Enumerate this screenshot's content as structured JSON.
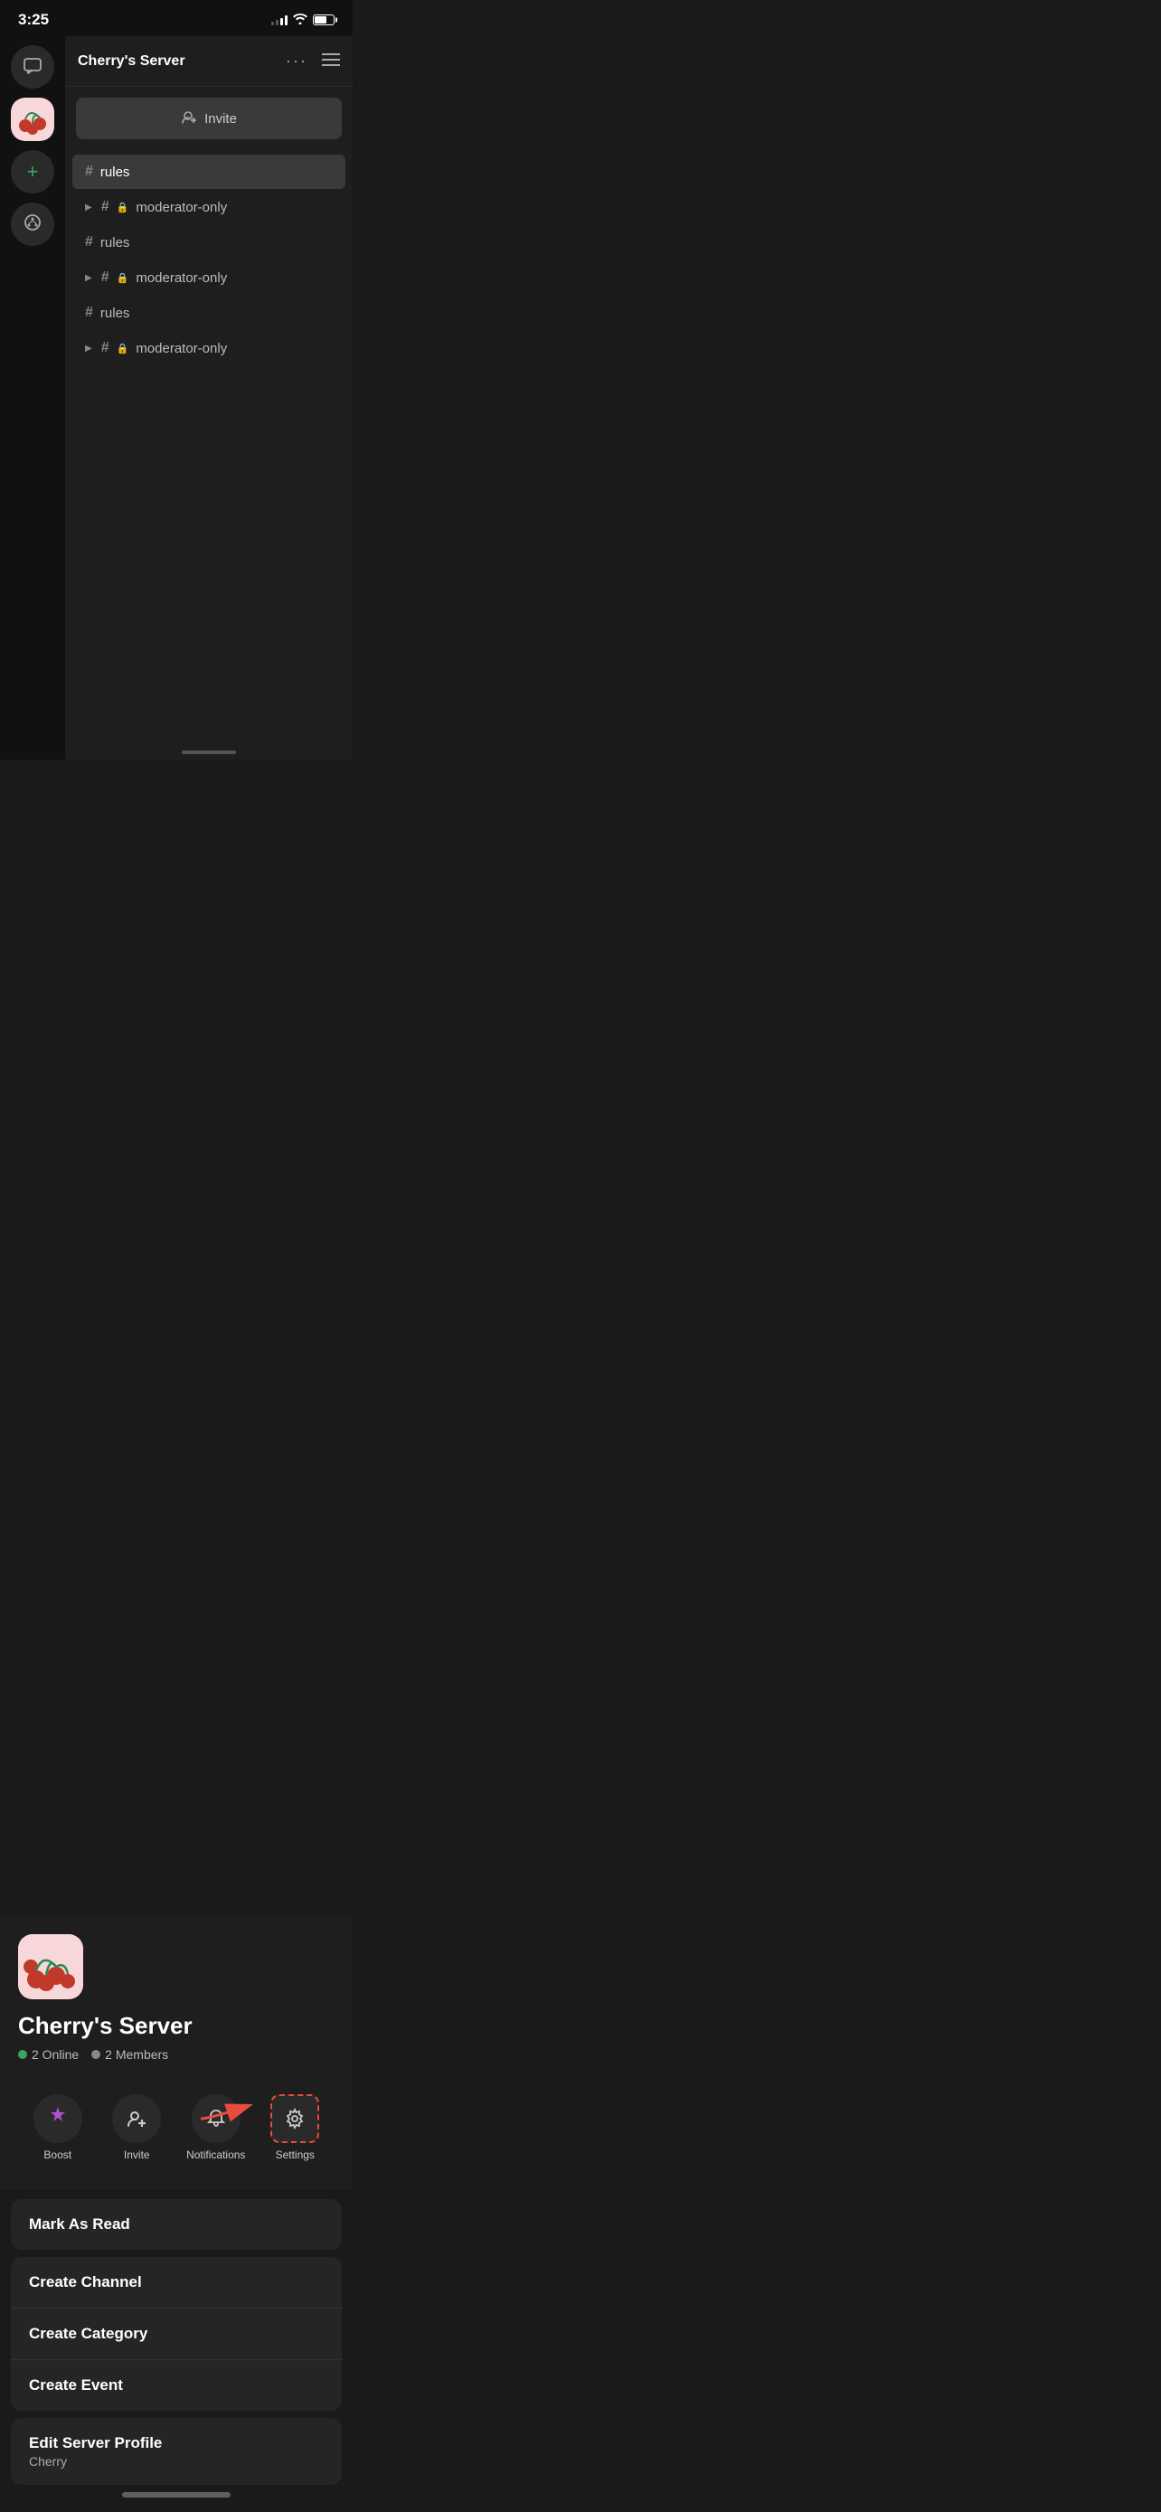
{
  "statusBar": {
    "time": "3:25"
  },
  "sidebar": {
    "items": [
      {
        "id": "messages",
        "icon": "💬",
        "type": "icon"
      },
      {
        "id": "cherry-server",
        "type": "server-image"
      },
      {
        "id": "add-server",
        "icon": "+",
        "type": "icon"
      },
      {
        "id": "discover",
        "icon": "⑂",
        "type": "icon"
      }
    ]
  },
  "channelList": {
    "serverName": "Cherry's Server",
    "inviteLabel": "Invite",
    "channels": [
      {
        "name": "rules",
        "type": "text",
        "active": true
      },
      {
        "name": "moderator-only",
        "type": "locked",
        "collapsed": true
      },
      {
        "name": "rules",
        "type": "text"
      },
      {
        "name": "moderator-only",
        "type": "locked",
        "collapsed": true
      },
      {
        "name": "rules",
        "type": "text"
      },
      {
        "name": "moderator-only",
        "type": "locked",
        "collapsed": true
      }
    ]
  },
  "serverInfo": {
    "title": "Cherry's Server",
    "online": "2 Online",
    "members": "2 Members"
  },
  "actionButtons": [
    {
      "id": "boost",
      "label": "Boost",
      "icon": "boost"
    },
    {
      "id": "invite",
      "label": "Invite",
      "icon": "invite"
    },
    {
      "id": "notifications",
      "label": "Notifications",
      "icon": "bell"
    },
    {
      "id": "settings",
      "label": "Settings",
      "icon": "gear"
    }
  ],
  "menuItems": {
    "group1": [
      {
        "id": "mark-read",
        "label": "Mark As Read"
      }
    ],
    "group2": [
      {
        "id": "create-channel",
        "label": "Create Channel"
      },
      {
        "id": "create-category",
        "label": "Create Category"
      },
      {
        "id": "create-event",
        "label": "Create Event"
      }
    ],
    "group3": [
      {
        "id": "edit-server-profile",
        "label": "Edit Server Profile",
        "sub": "Cherry"
      }
    ]
  }
}
